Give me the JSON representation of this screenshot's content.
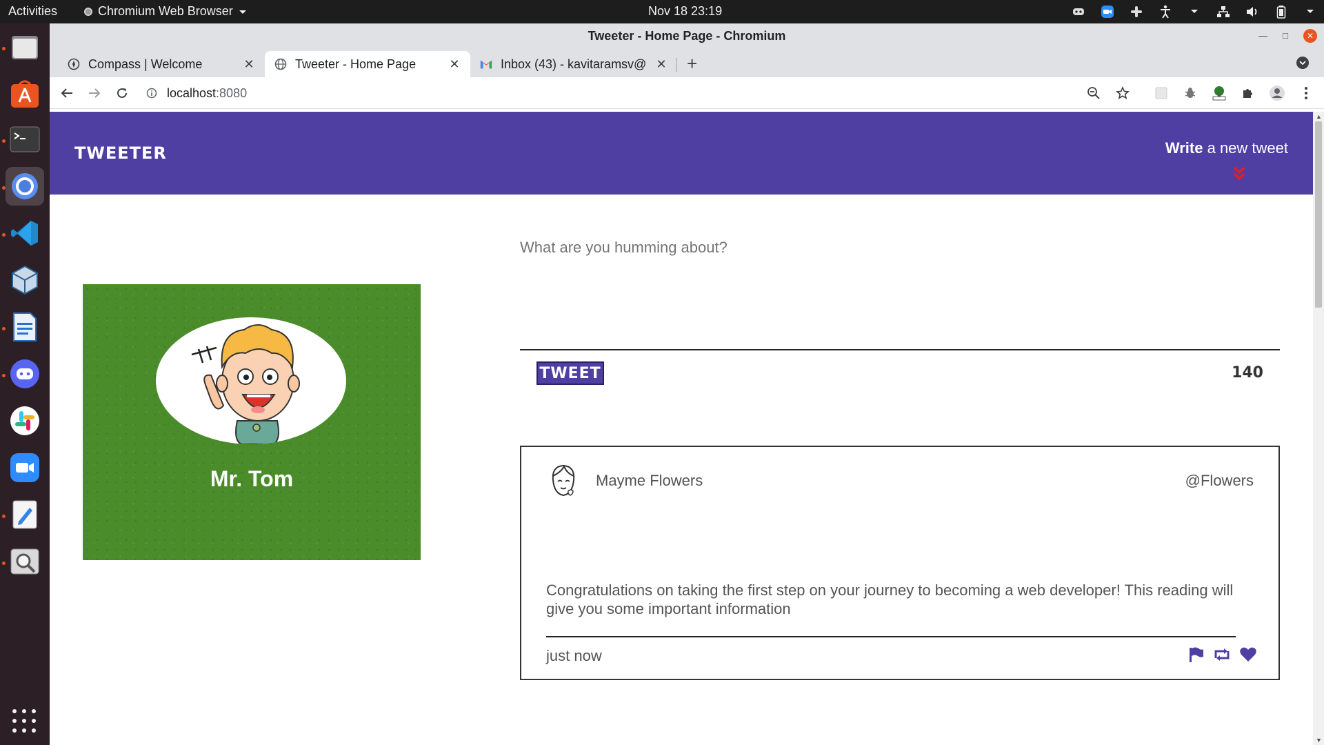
{
  "system_bar": {
    "activities": "Activities",
    "app_name": "Chromium Web Browser",
    "clock": "Nov 18  23:19"
  },
  "dock": {
    "items": [
      "files",
      "ubuntu-software",
      "terminal",
      "chromium",
      "vscode",
      "virtualbox",
      "libreoffice-writer",
      "discord",
      "slack",
      "zoom",
      "text-editor",
      "screenshot"
    ],
    "show_apps_icon": "apps-grid-icon"
  },
  "window": {
    "title": "Tweeter - Home Page - Chromium"
  },
  "tabs": [
    {
      "label": "Compass | Welcome",
      "icon": "compass-icon",
      "active": false
    },
    {
      "label": "Tweeter - Home Page",
      "icon": "globe-icon",
      "active": true
    },
    {
      "label": "Inbox (43) - kavitaramsv@",
      "icon": "gmail-icon",
      "active": false
    }
  ],
  "toolbar": {
    "url_host": "localhost",
    "url_port": ":8080"
  },
  "site": {
    "brand": "TWEETER",
    "compose_bold": "Write",
    "compose_rest": " a new tweet",
    "accent_color": "#4f3fa3",
    "profile": {
      "name": "Mr. Tom",
      "background_color": "#4a8c2a"
    },
    "composer": {
      "placeholder": "What are you humming about?",
      "button": "TWEET",
      "counter": "140"
    },
    "tweet": {
      "author": "Mayme Flowers",
      "handle": "@Flowers",
      "body": "Congratulations on taking the first step on your journey to becoming a web developer! This reading will give you some important information",
      "time": "just now",
      "actions": [
        "flag-icon",
        "retweet-icon",
        "heart-icon"
      ]
    }
  }
}
